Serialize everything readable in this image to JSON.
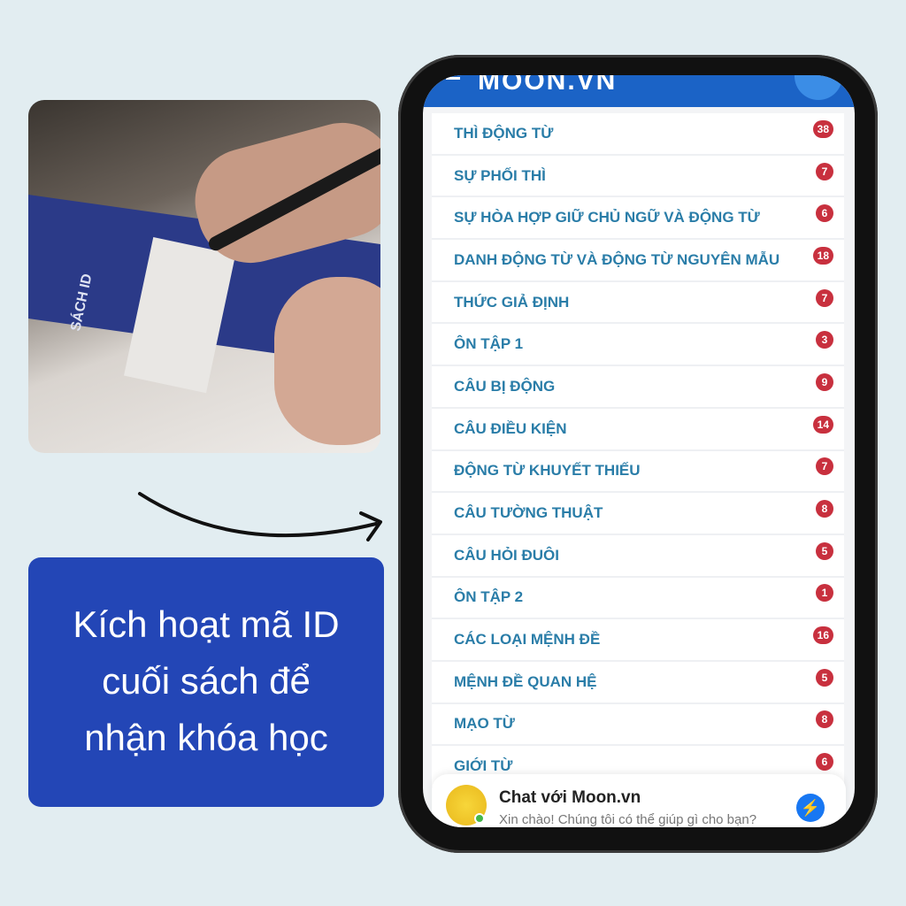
{
  "caption": {
    "line1": "Kích hoạt mã ID",
    "line2": "cuối sách để",
    "line3": "nhận khóa học"
  },
  "photo": {
    "book_title": "SÁCH ID"
  },
  "app": {
    "logo": "MOON.VN",
    "header_color": "#1b63c6"
  },
  "topics": [
    {
      "label": "THÌ ĐỘNG TỪ",
      "count": "38"
    },
    {
      "label": "SỰ PHỐI THÌ",
      "count": "7"
    },
    {
      "label": "SỰ HÒA HỢP GIỮ CHỦ NGỮ VÀ ĐỘNG TỪ",
      "count": "6"
    },
    {
      "label": "DANH ĐỘNG TỪ VÀ ĐỘNG TỪ NGUYÊN MẪU",
      "count": "18"
    },
    {
      "label": "THỨC GIẢ ĐỊNH",
      "count": "7"
    },
    {
      "label": "ÔN TẬP 1",
      "count": "3"
    },
    {
      "label": "CÂU BỊ ĐỘNG",
      "count": "9"
    },
    {
      "label": "CÂU ĐIỀU KIỆN",
      "count": "14"
    },
    {
      "label": "ĐỘNG TỪ KHUYẾT THIẾU",
      "count": "7"
    },
    {
      "label": "CÂU TƯỜNG THUẬT",
      "count": "8"
    },
    {
      "label": "CÂU HỎI ĐUÔI",
      "count": "5"
    },
    {
      "label": "ÔN TẬP 2",
      "count": "1"
    },
    {
      "label": "CÁC LOẠI MỆNH ĐỀ",
      "count": "16"
    },
    {
      "label": "MỆNH ĐỀ QUAN HỆ",
      "count": "5"
    },
    {
      "label": "MẠO TỪ",
      "count": "8"
    },
    {
      "label": "GIỚI TỪ",
      "count": "6"
    }
  ],
  "chat": {
    "title": "Chat với Moon.vn",
    "subtitle": "Xin chào! Chúng tôi có thể giúp gì cho bạn?",
    "icon": "messenger-icon"
  }
}
